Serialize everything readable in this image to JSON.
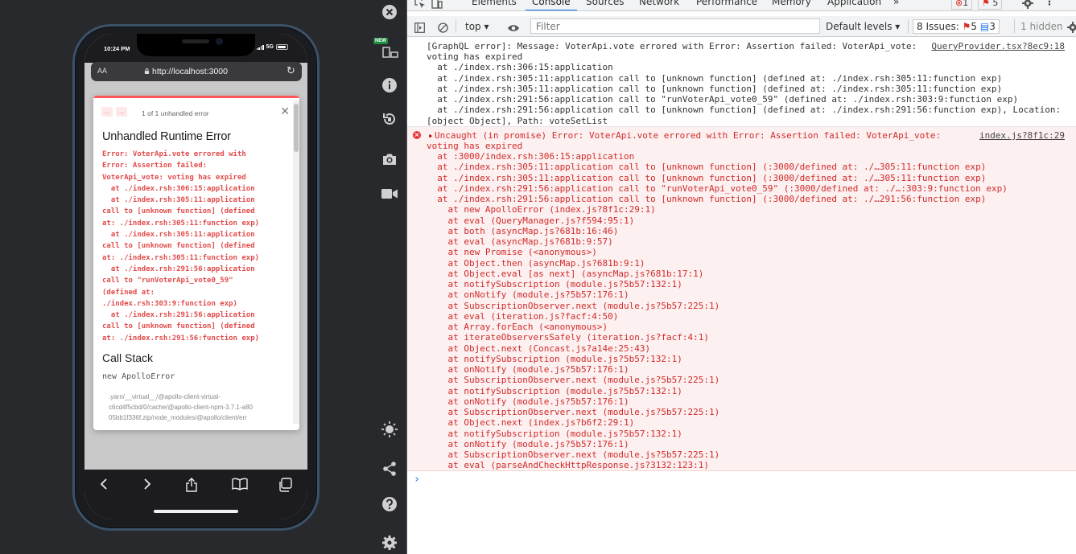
{
  "simulator": {
    "status_time": "10:24 PM",
    "network": "5G",
    "url_aa": "AA",
    "url": "http://localhost:3000",
    "overlay": {
      "error_count": "1 of 1 unhandled error",
      "title": "Unhandled Runtime Error",
      "message": "Error: VoterApi.vote errored with\nError: Assertion failed:\nVoterApi_vote: voting has expired\n  at ./index.rsh:306:15:application\n  at ./index.rsh:305:11:application\ncall to [unknown function] (defined\nat: ./index.rsh:305:11:function exp)\n  at ./index.rsh:305:11:application\ncall to [unknown function] (defined\nat: ./index.rsh:305:11:function exp)\n  at ./index.rsh:291:56:application\ncall to \"runVoterApi_vote0_59\"\n(defined at:\n./index.rsh:303:9:function exp)\n  at ./index.rsh:291:56:application\ncall to [unknown function] (defined\nat: ./index.rsh:291:56:function exp)",
      "call_stack_title": "Call Stack",
      "call_stack_fn": "new ApolloError",
      "call_stack_path": ".yarn/__virtual__/@apollo-client-virtual-\nc6cd4f5cbd/0/cache/@apollo-client-npm-3.7.1-a80\n05bb1f336f.zip/node_modules/@apollo/client/err"
    }
  },
  "devtools": {
    "tabs": [
      "Elements",
      "Console",
      "Sources",
      "Network",
      "Performance",
      "Memory",
      "Application"
    ],
    "active_tab": "Console",
    "more": "»",
    "badge_errors": "1",
    "badge_warnings": "5",
    "toolbar": {
      "context": "top",
      "filter_placeholder": "Filter",
      "levels": "Default levels",
      "issues_label": "8 Issues:",
      "issues_errors": "5",
      "issues_info": "3",
      "hidden": "1 hidden"
    },
    "messages": [
      {
        "source": "QueryProvider.tsx?8ec9:18",
        "lines": [
          "[GraphQL error]: Message: VoterApi.vote errored with Error: Assertion failed: VoterApi_vote:",
          "voting has expired",
          "  at ./index.rsh:306:15:application",
          "  at ./index.rsh:305:11:application call to [unknown function] (defined at: ./index.rsh:305:11:function exp)",
          "  at ./index.rsh:305:11:application call to [unknown function] (defined at: ./index.rsh:305:11:function exp)",
          "  at ./index.rsh:291:56:application call to \"runVoterApi_vote0_59\" (defined at: ./index.rsh:303:9:function exp)",
          "  at ./index.rsh:291:56:application call to [unknown function] (defined at: ./index.rsh:291:56:function exp), Location:",
          "[object Object], Path: voteSetList"
        ]
      },
      {
        "source": "index.js?8f1c:29",
        "lines": [
          "Uncaught (in promise) Error: VoterApi.vote errored with Error: Assertion failed: VoterApi_vote:",
          "voting has expired",
          "  at :3000/index.rsh:306:15:application",
          "  at ./index.rsh:305:11:application call to [unknown function] (:3000/defined at: ./…305:11:function exp)",
          "  at ./index.rsh:305:11:application call to [unknown function] (:3000/defined at: ./…305:11:function exp)",
          "  at ./index.rsh:291:56:application call to \"runVoterApi_vote0_59\" (:3000/defined at: ./…:303:9:function exp)",
          "  at ./index.rsh:291:56:application call to [unknown function] (:3000/defined at: ./…291:56:function exp)",
          "    at new ApolloError (index.js?8f1c:29:1)",
          "    at eval (QueryManager.js?f594:95:1)",
          "    at both (asyncMap.js?681b:16:46)",
          "    at eval (asyncMap.js?681b:9:57)",
          "    at new Promise (<anonymous>)",
          "    at Object.then (asyncMap.js?681b:9:1)",
          "    at Object.eval [as next] (asyncMap.js?681b:17:1)",
          "    at notifySubscription (module.js?5b57:132:1)",
          "    at onNotify (module.js?5b57:176:1)",
          "    at SubscriptionObserver.next (module.js?5b57:225:1)",
          "    at eval (iteration.js?facf:4:50)",
          "    at Array.forEach (<anonymous>)",
          "    at iterateObserversSafely (iteration.js?facf:4:1)",
          "    at Object.next (Concast.js?a14e:25:43)",
          "    at notifySubscription (module.js?5b57:132:1)",
          "    at onNotify (module.js?5b57:176:1)",
          "    at SubscriptionObserver.next (module.js?5b57:225:1)",
          "    at notifySubscription (module.js?5b57:132:1)",
          "    at onNotify (module.js?5b57:176:1)",
          "    at SubscriptionObserver.next (module.js?5b57:225:1)",
          "    at Object.next (index.js?b6f2:29:1)",
          "    at notifySubscription (module.js?5b57:132:1)",
          "    at onNotify (module.js?5b57:176:1)",
          "    at SubscriptionObserver.next (module.js?5b57:225:1)",
          "    at eval (parseAndCheckHttpResponse.js?3132:123:1)"
        ]
      }
    ],
    "prompt": "›"
  },
  "side_toolbar": {
    "new_badge": "NEW"
  }
}
